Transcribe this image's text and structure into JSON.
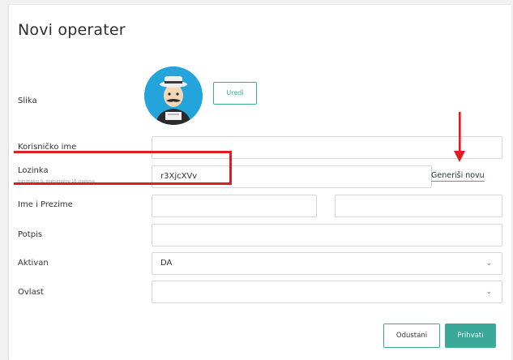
{
  "dialog": {
    "title": "Novi operater"
  },
  "fields": {
    "slika_label": "Slika",
    "uredi_label": "Uredi",
    "korisnicko_label": "Korisničko ime",
    "korisnicko_value": "",
    "lozinka_label": "Lozinka",
    "lozinka_hint": "minimalno 6, maksimalno 16 znakova",
    "lozinka_value": "r3XjcXVv",
    "generisi_label": "Generiši novu",
    "ime_label": "Ime i Prezime",
    "ime_value": "",
    "prezime_value": "",
    "potpis_label": "Potpis",
    "potpis_value": "",
    "aktivan_label": "Aktivan",
    "aktivan_value": "DA",
    "ovlast_label": "Ovlast",
    "ovlast_value": ""
  },
  "footer": {
    "cancel_label": "Odustani",
    "accept_label": "Prihvati"
  },
  "colors": {
    "accent": "#3aa99a",
    "avatar_bg": "#23a5dc",
    "annotation": "#e01b22"
  }
}
